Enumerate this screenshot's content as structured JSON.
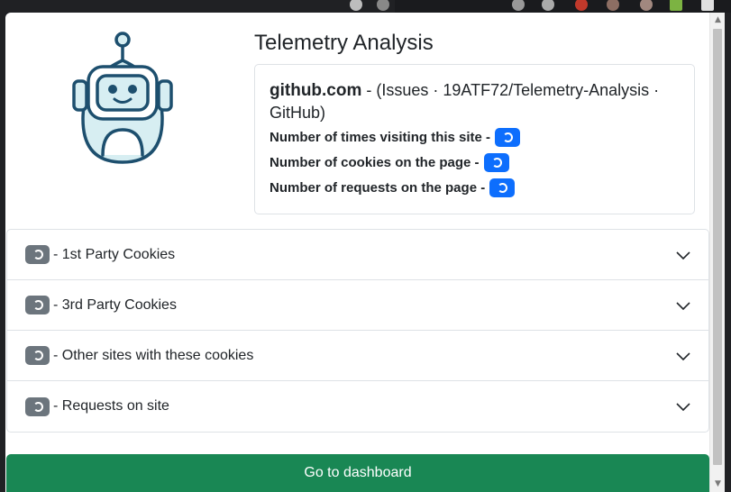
{
  "app": {
    "title": "Telemetry Analysis"
  },
  "site": {
    "domain": "github.com",
    "separator": " - ",
    "page_title": "(Issues · 19ATF72/Telemetry-Analysis · GitHub)"
  },
  "stats": [
    {
      "label": "Number of times visiting this site -",
      "icon": "loading-spinner-icon"
    },
    {
      "label": "Number of cookies on the page -",
      "icon": "loading-spinner-icon"
    },
    {
      "label": "Number of requests on the page -",
      "icon": "loading-spinner-icon"
    }
  ],
  "accordion": [
    {
      "label": "- 1st Party Cookies"
    },
    {
      "label": "- 3rd Party Cookies"
    },
    {
      "label": "- Other sites with these cookies"
    },
    {
      "label": "- Requests on site"
    }
  ],
  "actions": {
    "dashboard_label": "Go to dashboard"
  },
  "colors": {
    "primary": "#0d6efd",
    "secondary": "#6c757d",
    "success": "#198754",
    "robot_stroke": "#1d4f6e",
    "robot_fill": "#d7eef2"
  }
}
